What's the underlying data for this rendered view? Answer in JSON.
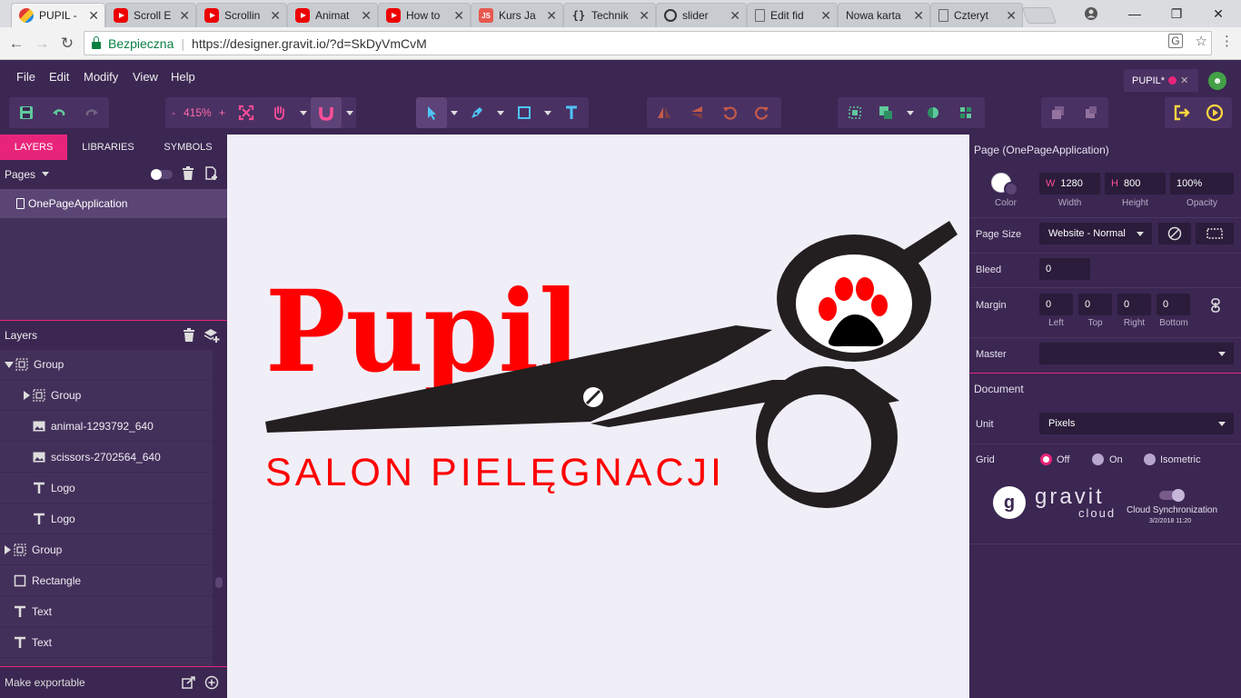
{
  "browser": {
    "tabs": [
      {
        "title": "PUPIL - ",
        "icon": "gravit-favicon",
        "active": true
      },
      {
        "title": "Scroll E",
        "icon": "youtube-icon"
      },
      {
        "title": "Scrollin",
        "icon": "youtube-icon"
      },
      {
        "title": "Animat",
        "icon": "youtube-icon"
      },
      {
        "title": "How to",
        "icon": "youtube-icon"
      },
      {
        "title": "Kurs Ja",
        "icon": "js-icon"
      },
      {
        "title": "Technik",
        "icon": "braces-icon"
      },
      {
        "title": "slider",
        "icon": "codepen-icon"
      },
      {
        "title": "Edit fid",
        "icon": "document-icon"
      },
      {
        "title": "Nowa karta",
        "icon": "none"
      },
      {
        "title": "Czteryt",
        "icon": "document-icon"
      }
    ],
    "secure_label": "Bezpieczna",
    "url": "https://designer.gravit.io/?d=SkDyVmCvM"
  },
  "app": {
    "menu": [
      "File",
      "Edit",
      "Modify",
      "View",
      "Help"
    ],
    "doc_tab": "PUPIL*",
    "zoom": "415%",
    "zoom_minus": "-",
    "zoom_plus": "+"
  },
  "left": {
    "tabs": [
      "LAYERS",
      "LIBRARIES",
      "SYMBOLS"
    ],
    "pages_label": "Pages",
    "page_name": "OnePageApplication",
    "layers_label": "Layers",
    "layers": [
      {
        "name": "Group",
        "icon": "group-icon",
        "expand": "down",
        "indent": 0
      },
      {
        "name": "Group",
        "icon": "group-icon",
        "expand": "right",
        "indent": 1
      },
      {
        "name": "animal-1293792_640",
        "icon": "image-icon",
        "expand": "none",
        "indent": 1
      },
      {
        "name": "scissors-2702564_640",
        "icon": "image-icon",
        "expand": "none",
        "indent": 1
      },
      {
        "name": "Logo",
        "icon": "text-icon",
        "expand": "none",
        "indent": 1
      },
      {
        "name": "Logo",
        "icon": "text-icon",
        "expand": "none",
        "indent": 1
      },
      {
        "name": "Group",
        "icon": "group-icon",
        "expand": "right",
        "indent": 0
      },
      {
        "name": "Rectangle",
        "icon": "rectangle-icon",
        "expand": "none",
        "indent": 0
      },
      {
        "name": "Text",
        "icon": "text-icon",
        "expand": "none",
        "indent": 0
      },
      {
        "name": "Text",
        "icon": "text-icon",
        "expand": "none",
        "indent": 0
      }
    ],
    "export_label": "Make exportable"
  },
  "canvas": {
    "logo_title": "Pupil",
    "logo_subtitle": "SALON PIELĘGNACJI",
    "logo_color": "#ff0000",
    "scissors_color": "#231f20"
  },
  "right": {
    "page_title": "Page (OnePageApplication)",
    "color_label": "Color",
    "width_prefix": "W",
    "width_value": "1280",
    "width_label": "Width",
    "height_prefix": "H",
    "height_value": "800",
    "height_label": "Height",
    "opacity_value": "100%",
    "opacity_label": "Opacity",
    "page_size_label": "Page Size",
    "page_size_value": "Website - Normal",
    "bleed_label": "Bleed",
    "bleed_value": "0",
    "margin_label": "Margin",
    "margin_left": "0",
    "margin_top": "0",
    "margin_right": "0",
    "margin_bottom": "0",
    "margin_left_label": "Left",
    "margin_top_label": "Top",
    "margin_right_label": "Right",
    "margin_bottom_label": "Bottom",
    "master_label": "Master",
    "document_label": "Document",
    "unit_label": "Unit",
    "unit_value": "Pixels",
    "grid_label": "Grid",
    "grid_off": "Off",
    "grid_on": "On",
    "grid_iso": "Isometric",
    "brand_top": "gravit",
    "brand_bottom": "cloud",
    "sync_label": "Cloud Synchronization",
    "sync_date": "3/2/2018 11:20"
  },
  "colors": {
    "accent": "#e8247a",
    "panel": "#3b2752",
    "panel_light": "#43305a"
  }
}
